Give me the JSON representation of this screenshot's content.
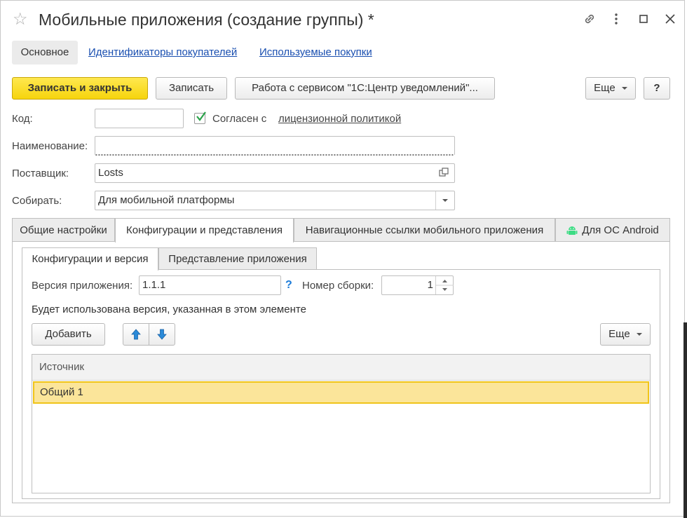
{
  "window": {
    "title": "Мобильные приложения (создание группы) *",
    "star_icon": "☆",
    "link_icon": "🔗",
    "more_icon": "⋮",
    "maximize_icon": "☐",
    "close_icon": "✕"
  },
  "nav": {
    "tabs": [
      "Основное",
      "Идентификаторы покупателей",
      "Используемые покупки"
    ]
  },
  "toolbar": {
    "save_close": "Записать и закрыть",
    "save": "Записать",
    "service": "Работа с сервисом \"1С:Центр уведомлений\"...",
    "more": "Еще",
    "help": "?"
  },
  "form": {
    "code_label": "Код:",
    "code_value": "",
    "agree_label": "Согласен с",
    "agree_checked": true,
    "license_link": "лицензионной политикой",
    "name_label": "Наименование:",
    "name_value": "",
    "supplier_label": "Поставщик:",
    "supplier_value": "Losts",
    "build_label": "Собирать:",
    "build_value": "Для мобильной платформы"
  },
  "tabs": [
    "Общие настройки",
    "Конфигурации и представления",
    "Навигационные ссылки мобильного приложения",
    "Для ОС Android"
  ],
  "subtabs": [
    "Конфигурации и версия",
    "Представление приложения"
  ],
  "config": {
    "version_label": "Версия приложения:",
    "version_value": "1.1.1",
    "help_mark": "?",
    "build_number_label": "Номер сборки:",
    "build_number_value": "1",
    "note": "Будет использована версия, указанная в этом элементе",
    "add_button": "Добавить",
    "more_button": "Еще",
    "table_header": "Источник",
    "rows": [
      "Общий 1"
    ]
  },
  "colors": {
    "primary_button": "#f6d40d",
    "link": "#1a4fb0",
    "selected_row": "#fbe59a",
    "selected_row_border": "#f0c419",
    "arrow_blue": "#2a8ad8",
    "check_green": "#2aa34a",
    "android_green": "#3ddc84"
  }
}
